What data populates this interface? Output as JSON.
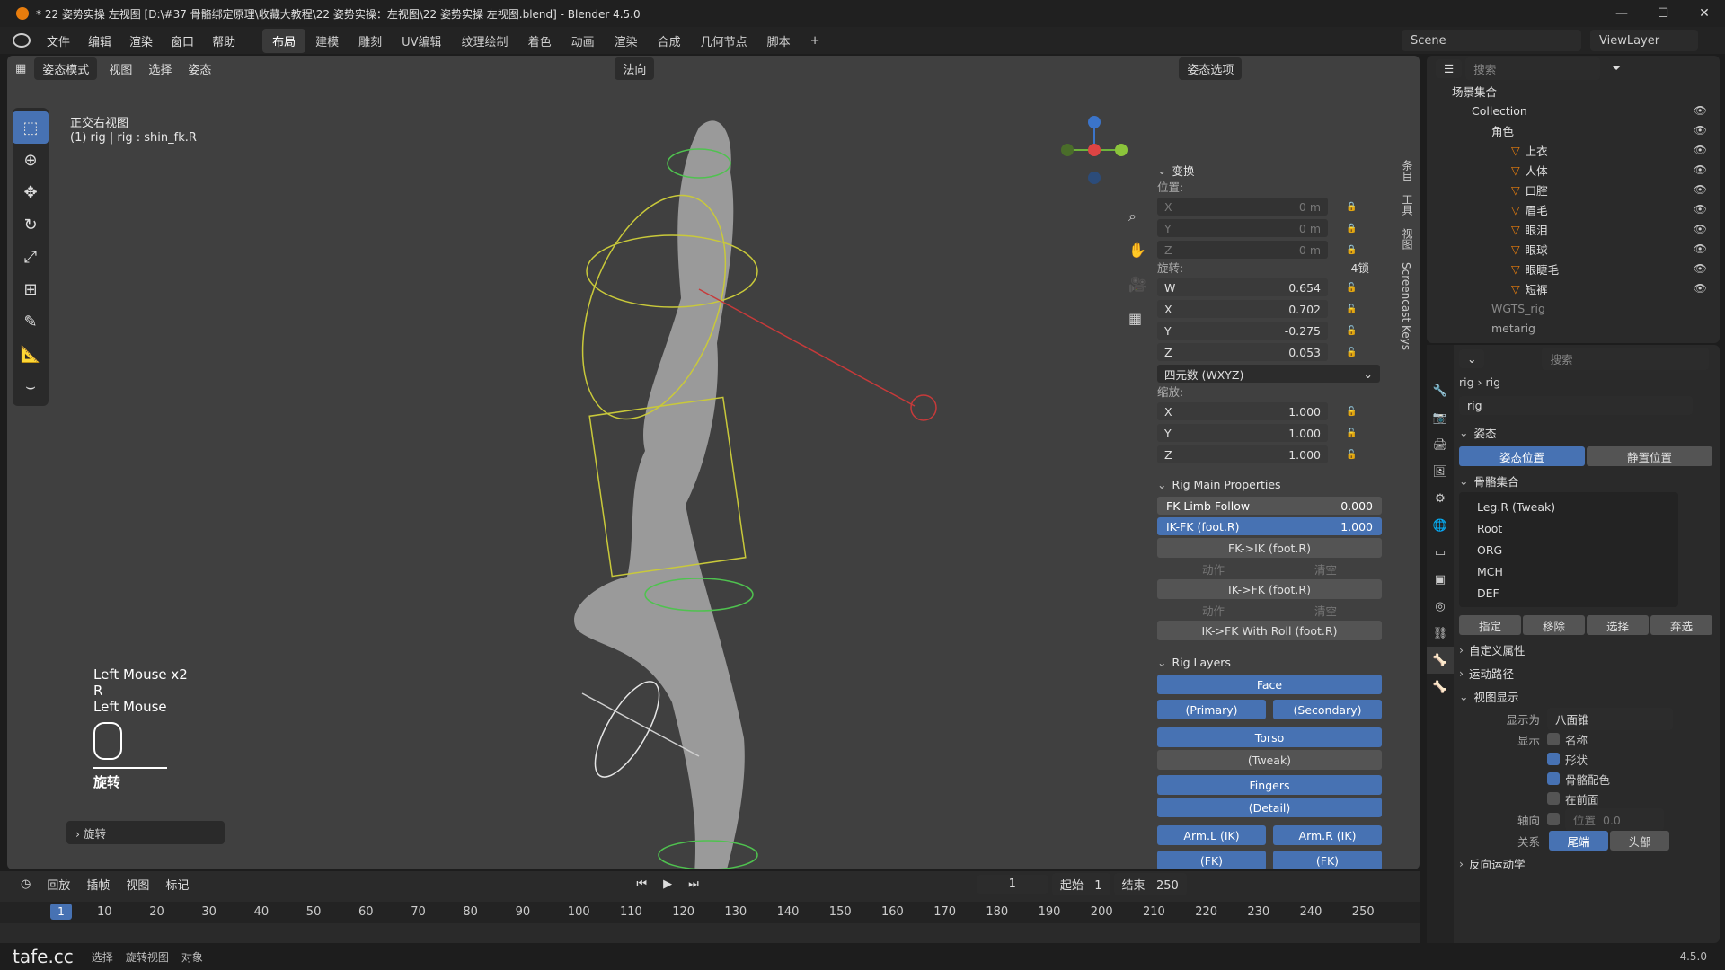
{
  "title": "* 22 姿势实操 左视图 [D:\\#37 骨骼绑定原理\\收藏大教程\\22 姿势实操：左视图\\22 姿势实操 左视图.blend] - Blender 4.5.0",
  "menus": [
    "文件",
    "编辑",
    "渲染",
    "窗口",
    "帮助"
  ],
  "workspaces": [
    "布局",
    "建模",
    "雕刻",
    "UV编辑",
    "纹理绘制",
    "着色",
    "动画",
    "渲染",
    "合成",
    "几何节点",
    "脚本"
  ],
  "scene": "Scene",
  "viewlayer": "ViewLayer",
  "vp_header": {
    "mode": "姿态模式",
    "view": "视图",
    "select": "选择",
    "pose": "姿态",
    "orient": "法向",
    "pose_options": "姿态选项"
  },
  "vp_info": {
    "view": "正交右视图",
    "obj": "(1) rig | rig : shin_fk.R"
  },
  "keys": {
    "line1": "Left Mouse x2",
    "line2": "R",
    "line3": "Left Mouse",
    "op": "旋转",
    "redo": "旋转"
  },
  "npanel": {
    "transform": "变换",
    "location": "位置:",
    "loc": [
      {
        "a": "X",
        "v": "0 m"
      },
      {
        "a": "Y",
        "v": "0 m"
      },
      {
        "a": "Z",
        "v": "0 m"
      }
    ],
    "rotation": "旋转:",
    "rot_mode": "4锁",
    "rot": [
      {
        "a": "W",
        "v": "0.654"
      },
      {
        "a": "X",
        "v": "0.702"
      },
      {
        "a": "Y",
        "v": "-0.275"
      },
      {
        "a": "Z",
        "v": "0.053"
      }
    ],
    "rot_type": "四元数 (WXYZ)",
    "scale": "缩放:",
    "scl": [
      {
        "a": "X",
        "v": "1.000"
      },
      {
        "a": "Y",
        "v": "1.000"
      },
      {
        "a": "Z",
        "v": "1.000"
      }
    ],
    "rig_main": "Rig Main Properties",
    "fk_follow": "FK Limb Follow",
    "fk_follow_v": "0.000",
    "ikfk": "IK-FK (foot.R)",
    "ikfk_v": "1.000",
    "fk2ik": "FK->IK (foot.R)",
    "ik2fk": "IK->FK (foot.R)",
    "ik2fk_roll": "IK->FK With Roll (foot.R)",
    "action": "动作",
    "clear": "清空",
    "rig_layers": "Rig Layers",
    "face": "Face",
    "primary": "(Primary)",
    "secondary": "(Secondary)",
    "torso": "Torso",
    "tweak": "(Tweak)",
    "fingers": "Fingers",
    "detail": "(Detail)",
    "arml": "Arm.L (IK)",
    "armr": "Arm.R (IK)",
    "fk": "(FK)",
    "tabs": [
      "Screencast Keys",
      "视图",
      "工具",
      "条目"
    ]
  },
  "timeline": {
    "playback": "回放",
    "keying": "插帧",
    "view": "视图",
    "marker": "标记",
    "current": "1",
    "start_l": "起始",
    "start": "1",
    "end_l": "结束",
    "end": "250",
    "ticks": [
      "10",
      "20",
      "30",
      "40",
      "50",
      "60",
      "70",
      "80",
      "90",
      "100",
      "110",
      "120",
      "130",
      "140",
      "150",
      "160",
      "170",
      "180",
      "190",
      "200",
      "210",
      "220",
      "230",
      "240",
      "250"
    ],
    "frame": "1"
  },
  "status": {
    "a": "选择",
    "b": "旋转视图",
    "c": "对象",
    "ver": "4.5.0",
    "watermark": "tafe.cc"
  },
  "outliner": {
    "search": "搜索",
    "root": "场景集合",
    "coll": "Collection",
    "role": "角色",
    "items": [
      "上衣",
      "人体",
      "口腔",
      "眉毛",
      "眼泪",
      "眼球",
      "眼睫毛",
      "短裤"
    ],
    "wgts": "WGTS_rig",
    "metarig": "metarig"
  },
  "props": {
    "search": "搜索",
    "bc1": "rig",
    "bc2": "rig",
    "name": "rig",
    "pose": "姿态",
    "pose_pos": "姿态位置",
    "rest_pos": "静置位置",
    "bone_coll": "骨骼集合",
    "colls": [
      "Leg.R (Tweak)",
      "Root",
      "ORG",
      "MCH",
      "DEF"
    ],
    "assign": "指定",
    "remove": "移除",
    "select": "选择",
    "deselect": "弃选",
    "custom": "自定义属性",
    "motion": "运动路径",
    "vdisp": "视图显示",
    "show_as": "显示为",
    "show_as_v": "八面锥",
    "show": "显示",
    "name_l": "名称",
    "shape": "形状",
    "bone_color": "骨骼配色",
    "infront": "在前面",
    "axes": "轴向",
    "pos": "位置",
    "pos_v": "0.0",
    "rel": "关系",
    "tail": "尾端",
    "head": "头部",
    "ik": "反向运动学"
  }
}
